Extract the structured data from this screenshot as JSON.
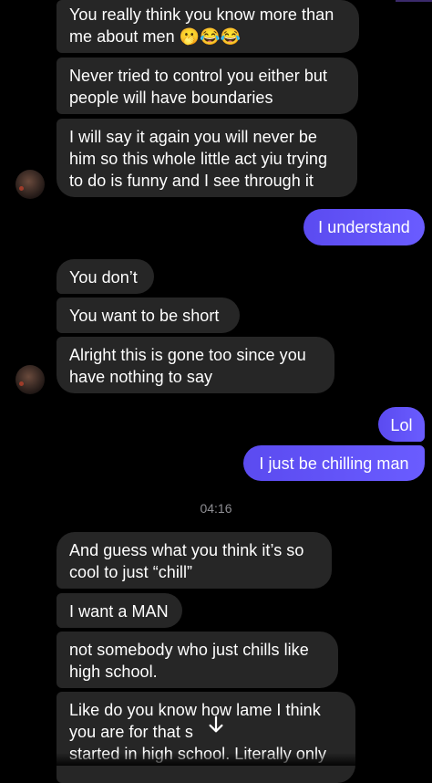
{
  "thread": {
    "messages": [
      {
        "sender": "them",
        "lines": [
          "You really think you know more than",
          "me about men 🫢😂😂"
        ]
      },
      {
        "sender": "them",
        "lines": [
          "Never tried to control you either but",
          "people will have boundaries"
        ]
      },
      {
        "sender": "them",
        "lines": [
          "I will say it again you will never be",
          "him so this whole little act yiu trying",
          "to do is funny and I see through it"
        ]
      },
      {
        "sender": "me",
        "lines": [
          "I understand"
        ]
      },
      {
        "sender": "them",
        "lines": [
          "You don’t"
        ]
      },
      {
        "sender": "them",
        "lines": [
          "You want to be short"
        ]
      },
      {
        "sender": "them",
        "lines": [
          "Alright this is gone too since you",
          "have nothing to say"
        ]
      },
      {
        "sender": "me",
        "lines": [
          "Lol"
        ]
      },
      {
        "sender": "me",
        "lines": [
          "I just be chilling man"
        ]
      },
      {
        "sender": "them",
        "lines": [
          "And guess what you think it’s so",
          "cool to just “chill”"
        ]
      },
      {
        "sender": "them",
        "lines": [
          "I want a MAN"
        ]
      },
      {
        "sender": "them",
        "lines": [
          "not somebody who just chills like",
          "high school."
        ]
      },
      {
        "sender": "them",
        "lines": [
          "Like do you know how lame I think",
          "you are for that s",
          "started in high school. Literally only"
        ]
      }
    ],
    "timestamp": "04:16"
  },
  "colors": {
    "background": "#000000",
    "incoming_bubble": "#262626",
    "outgoing_bubble": "#6a5cff",
    "text": "#ffffff",
    "timestamp": "#8e8e93"
  },
  "icons": {
    "scroll_down": "arrow-down-icon",
    "avatar": "contact-avatar"
  }
}
